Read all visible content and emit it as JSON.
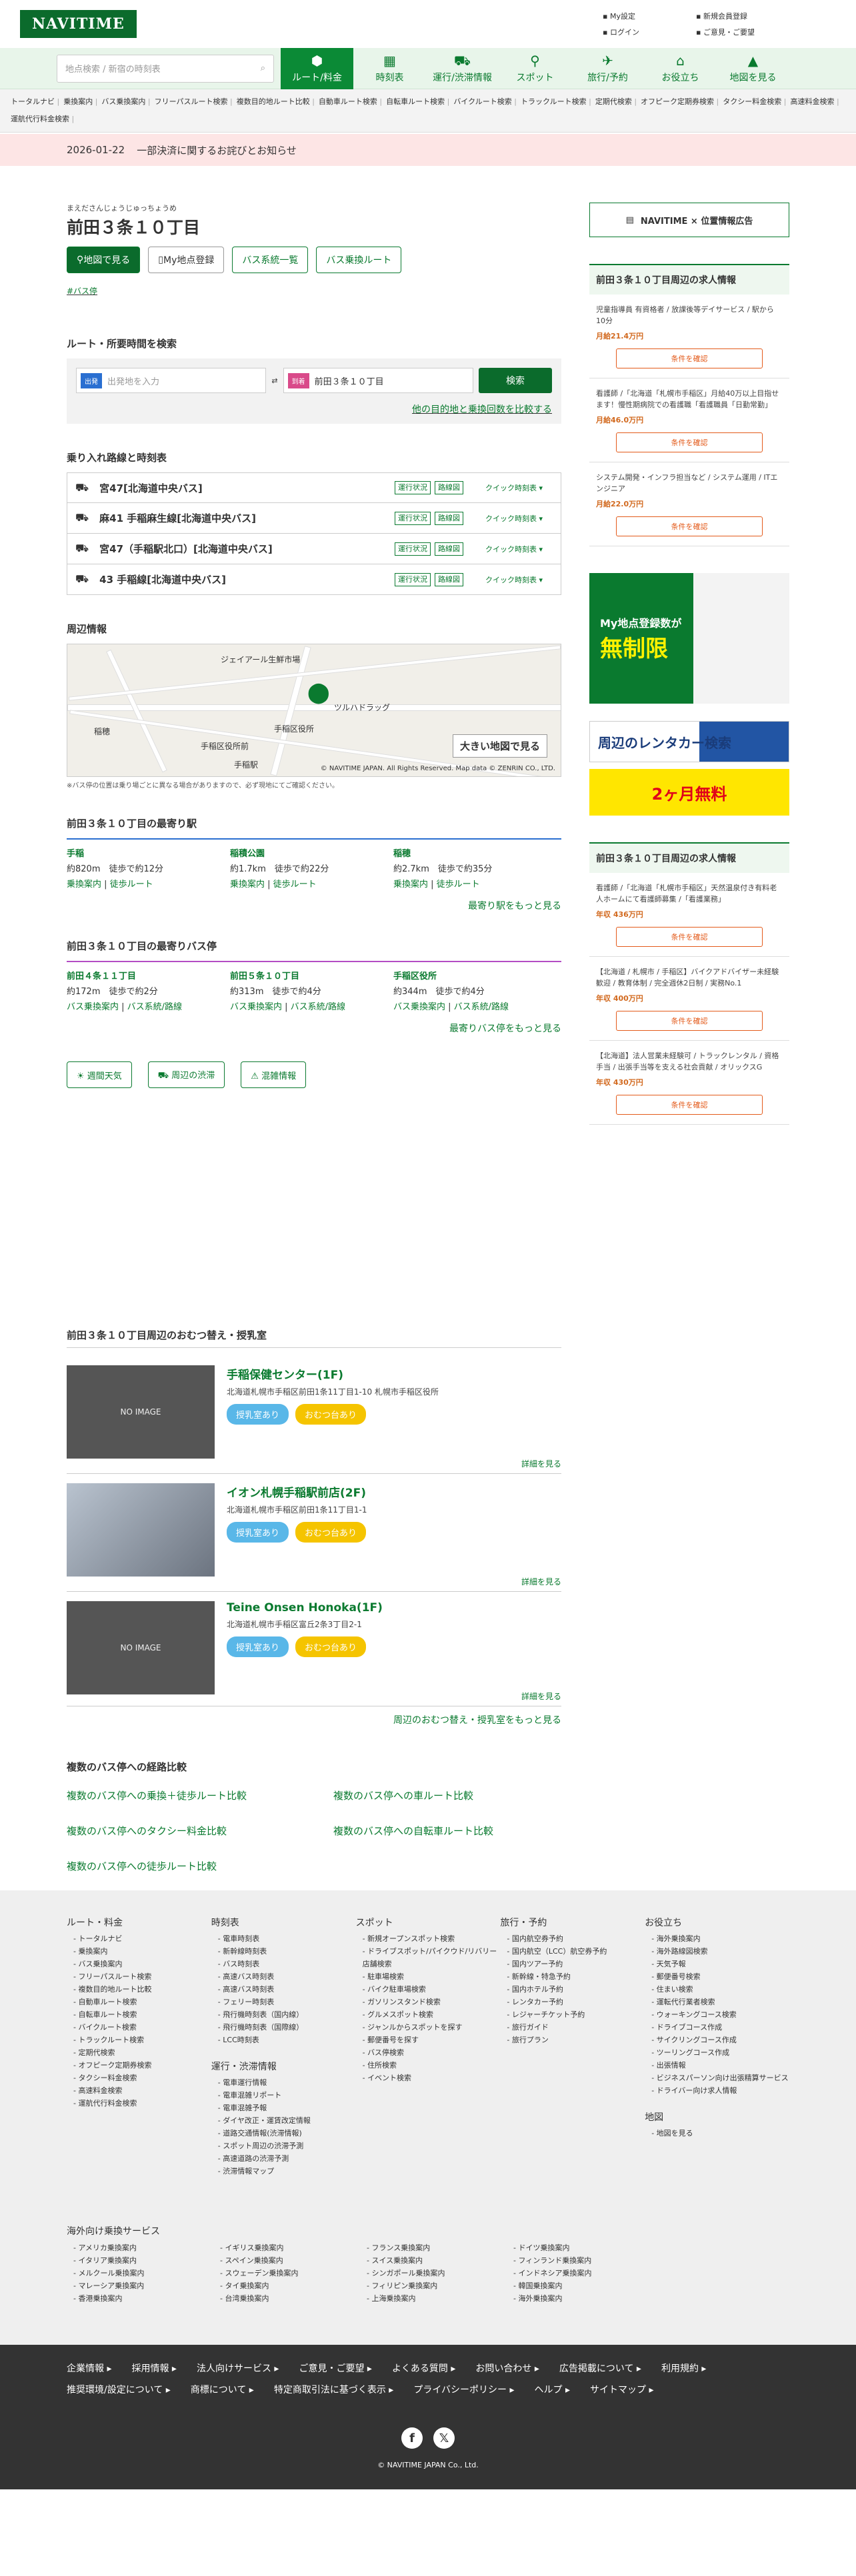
{
  "header": {
    "logo": "NAVITIME",
    "links": [
      "My設定",
      "新規会員登録",
      "ログイン",
      "ご意見・ご要望"
    ]
  },
  "nav": {
    "search_placeholder": "地点検索 / 新宿の時刻表",
    "items": [
      {
        "icon": "⬢",
        "label": "ルート/料金"
      },
      {
        "icon": "▦",
        "label": "時刻表"
      },
      {
        "icon": "⛟",
        "label": "運行/渋滞情報"
      },
      {
        "icon": "⚲",
        "label": "スポット"
      },
      {
        "icon": "✈",
        "label": "旅行/予約"
      },
      {
        "icon": "⌂",
        "label": "お役立ち"
      },
      {
        "icon": "▲",
        "label": "地図を見る"
      }
    ]
  },
  "subnav": [
    "トータルナビ",
    "乗換案内",
    "バス乗換案内",
    "フリーパスルート検索",
    "複数目的地ルート比較",
    "自動車ルート検索",
    "自転車ルート検索",
    "バイクルート検索",
    "トラックルート検索",
    "定期代検索",
    "オフピーク定期券検索",
    "タクシー料金検索",
    "高速料金検索",
    "運航代行料金検索"
  ],
  "notice": {
    "date": "2026-01-22",
    "text": "一部決済に関するお詫びとお知らせ"
  },
  "spot": {
    "ruby": "まえださんじょうじゅっちょうめ",
    "name": "前田３条１０丁目",
    "btn_map": "地図で見る",
    "btn_my": "My地点登録",
    "btn_bus": "バス系統一覧",
    "btn_route": "バス乗換ルート",
    "tag": "#バス停"
  },
  "route": {
    "title": "ルート・所要時間を検索",
    "from_tag": "出発",
    "from_ph": "出発地を入力",
    "to_tag": "到着",
    "to_val": "前田３条１０丁目",
    "search": "検索",
    "link": "他の目的地と乗換回数を比較する"
  },
  "lines": {
    "title": "乗り入れ路線と時刻表",
    "items": [
      "宮47[北海道中央バス]",
      "麻41 手稲麻生線[北海道中央バス]",
      "宮47（手稲駅北口）[北海道中央バス]",
      "43 手稲線[北海道中央バス]"
    ],
    "status": "運行状況",
    "route": "路線図",
    "quick": "クイック時刻表 ▾"
  },
  "map": {
    "title": "周辺情報",
    "labels": [
      "ジェイアール生鮮市場",
      "手稲区役所",
      "ツルハドラッグ",
      "手稲駅",
      "手稲区役所前",
      "稲穂"
    ],
    "big": "大きい地図で見る",
    "copy": "© NAVITIME JAPAN. All Rights Reserved. Map data © ZENRIN CO., LTD.",
    "note": "※バス停の位置は乗り場ごとに異なる場合がありますので、必ず現地にてご確認ください。"
  },
  "stations": {
    "title": "前田３条１０丁目の最寄り駅",
    "items": [
      {
        "n": "手稲",
        "d": "約820m　徒歩で約12分"
      },
      {
        "n": "稲積公園",
        "d": "約1.7km　徒歩で約22分"
      },
      {
        "n": "稲穂",
        "d": "約2.7km　徒歩で約35分"
      }
    ],
    "l1": "乗換案内",
    "l2": "徒歩ルート",
    "more": "最寄り駅をもっと見る"
  },
  "stops": {
    "title": "前田３条１０丁目の最寄りバス停",
    "items": [
      {
        "n": "前田４条１１丁目",
        "d": "約172m　徒歩で約2分"
      },
      {
        "n": "前田５条１０丁目",
        "d": "約313m　徒歩で約4分"
      },
      {
        "n": "手稲区役所",
        "d": "約344m　徒歩で約4分"
      }
    ],
    "l1": "バス乗換案内",
    "l2": "バス系統/路線",
    "more": "最寄りバス停をもっと見る"
  },
  "pills": [
    "☀ 週間天気",
    "⛟ 周辺の渋滞",
    "⚠ 混雑情報"
  ],
  "nursing": {
    "title": "前田３条１０丁目周辺のおむつ替え・授乳室",
    "noimg": "NO IMAGE",
    "chip1": "授乳室あり",
    "chip2": "おむつ台あり",
    "detail": "詳細を見る",
    "items": [
      {
        "n": "手稲保健センター(1F)",
        "a": "北海道札幌市手稲区前田1条11丁目1-10 札幌市手稲区役所",
        "img": false
      },
      {
        "n": "イオン札幌手稲駅前店(2F)",
        "a": "北海道札幌市手稲区前田1条11丁目1-1",
        "img": true
      },
      {
        "n": "Teine Onsen Honoka(1F)",
        "a": "北海道札幌市手稲区富丘2条3丁目2-1",
        "img": false
      }
    ],
    "more": "周辺のおむつ替え・授乳室をもっと見る"
  },
  "multi": {
    "title": "複数のバス停への経路比較",
    "items": [
      "複数のバス停への乗換＋徒歩ルート比較",
      "複数のバス停への車ルート比較",
      "複数のバス停へのタクシー料金比較",
      "複数のバス停への自転車ルート比較",
      "複数のバス停への徒歩ルート比較"
    ]
  },
  "side": {
    "banner": "NAVITIME × 位置情報広告",
    "jobs1": {
      "title": "前田３条１０丁目周辺の求人情報",
      "items": [
        {
          "t": "児童指導員 有資格者 / 放課後等デイサービス / 駅から10分",
          "s": "月給21.4万円"
        },
        {
          "t": "看護師 /「北海道「札幌市手稲区」月給40万以上目指せます！慢性期病院での看護職「看護職員「日勤常勤」",
          "s": "月給46.0万円"
        },
        {
          "t": "システム開発・インフラ担当など / システム運用 / ITエンジニア",
          "s": "月給22.0万円"
        }
      ],
      "btn": "条件を確認"
    },
    "ad1a": "My地点登録数が",
    "ad1b": "無制限",
    "ad2": "周辺のレンタカー検索",
    "ad3": "2ヶ月無料",
    "jobs2": {
      "title": "前田３条１０丁目周辺の求人情報",
      "items": [
        {
          "t": "看護師 /「北海道「札幌市手稲区」天然温泉付き有料老人ホームにて看護師募集 /「看護業務」",
          "s": "年収 436万円"
        },
        {
          "t": "【北海道 / 札幌市 / 手稲区】バイクアドバイザー未経験歓迎 / 教育体制 / 完全週休2日制 / 実務No.1",
          "s": "年収 400万円"
        },
        {
          "t": "【北海道】法人営業未経験可 / トラックレンタル / 資格手当 / 出張手当等を支える社会貢献 / オリックスG",
          "s": "年収 430万円"
        }
      ]
    }
  },
  "footer": {
    "cols": [
      {
        "h": "ルート・料金",
        "i": [
          "トータルナビ",
          "乗換案内",
          "バス乗換案内",
          "フリーパスルート検索",
          "複数目的地ルート比較",
          "自動車ルート検索",
          "自転車ルート検索",
          "バイクルート検索",
          "トラックルート検索",
          "定期代検索",
          "オフピーク定期券検索",
          "タクシー料金検索",
          "高速料金検索",
          "運航代行料金検索"
        ]
      },
      {
        "h": "時刻表",
        "i": [
          "電車時刻表",
          "新幹線時刻表",
          "バス時刻表",
          "高速バス時刻表",
          "高速バス時刻表",
          "フェリー時刻表",
          "飛行機時刻表（国内線）",
          "飛行機時刻表（国際線）",
          "LCC時刻表"
        ],
        "h2": "運行・渋滞情報",
        "i2": [
          "電車運行情報",
          "電車混雑リポート",
          "電車混雑予報",
          "ダイヤ改正・運賃改定情報",
          "道路交通情報(渋滞情報)",
          "スポット周辺の渋滞予測",
          "高速道路の渋滞予測",
          "渋滞情報マップ"
        ]
      },
      {
        "h": "スポット",
        "i": [
          "新規オープンスポット検索",
          "ドライブスポット/パイクウド/リバリー店舗検索",
          "駐車場検索",
          "バイク駐車場検索",
          "ガソリンスタンド検索",
          "グルメスポット検索",
          "ジャンルからスポットを探す",
          "郵便番号を探す",
          "バス停検索",
          "住所検索",
          "イベント検索"
        ]
      },
      {
        "h": "旅行・予約",
        "i": [
          "国内航空券予約",
          "国内航空（LCC）航空券予約",
          "国内ツアー予約",
          "新幹線・特急予約",
          "国内ホテル予約",
          "レンタカー予約",
          "レジャーチケット予約",
          "旅行ガイド",
          "旅行プラン"
        ]
      },
      {
        "h": "お役立ち",
        "i": [
          "海外乗換案内",
          "海外路線図検索",
          "天気予報",
          "郵便番号検索",
          "住まい検索",
          "運転代行業者検索",
          "ウォーキングコース検索",
          "ドライブコース作成",
          "サイクリングコース作成",
          "ツーリングコース作成",
          "出張情報",
          "ビジネスパーソン向け出張精算サービス",
          "ドライバー向け求人情報"
        ],
        "h2": "地図",
        "i2": [
          "地図を見る"
        ]
      }
    ],
    "abroad_title": "海外向け乗換サービス",
    "abroad": [
      "アメリカ乗換案内",
      "イギリス乗換案内",
      "フランス乗換案内",
      "ドイツ乗換案内",
      "イタリア乗換案内",
      "スペイン乗換案内",
      "スイス乗換案内",
      "フィンランド乗換案内",
      "メルクール乗換案内",
      "スウェーデン乗換案内",
      "シンガポール乗換案内",
      "インドネシア乗換案内",
      "マレーシア乗換案内",
      "タイ乗換案内",
      "フィリピン乗換案内",
      "韓国乗換案内",
      "香港乗換案内",
      "台湾乗換案内",
      "上海乗換案内",
      "海外乗換案内"
    ]
  },
  "bottom": {
    "links": [
      "企業情報 ▸",
      "採用情報 ▸",
      "法人向けサービス ▸",
      "ご意見・ご要望 ▸",
      "よくある質問 ▸",
      "お問い合わせ ▸",
      "広告掲載について ▸",
      "利用規約 ▸",
      "推奨環境/設定について ▸",
      "商標について ▸",
      "特定商取引法に基づく表示 ▸",
      "プライバシーポリシー ▸",
      "ヘルプ ▸",
      "サイトマップ ▸"
    ],
    "fb": "f",
    "x": "𝕏",
    "copy": "© NAVITIME JAPAN Co., Ltd."
  }
}
